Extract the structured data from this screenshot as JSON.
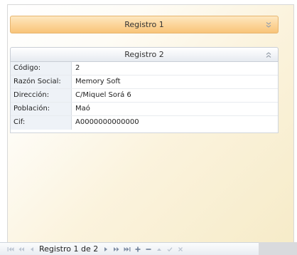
{
  "panels": [
    {
      "title": "Registro 1",
      "collapsed": true,
      "chevron": "double-chevron-down-icon"
    },
    {
      "title": "Registro 2",
      "collapsed": false,
      "chevron": "double-chevron-up-icon"
    }
  ],
  "record": {
    "fields": [
      {
        "label": "Código:",
        "value": "2"
      },
      {
        "label": "Razón Social:",
        "value": "Memory Soft"
      },
      {
        "label": "Dirección:",
        "value": "C/Miquel Sorá 6"
      },
      {
        "label": "Población:",
        "value": "Maó"
      },
      {
        "label": "Cif:",
        "value": "A0000000000000"
      }
    ]
  },
  "navigator": {
    "text": "Registro 1 de 2",
    "buttons": {
      "first": "⏮",
      "prev_page": "«",
      "prev": "◂",
      "next": "▸",
      "next_page": "»",
      "last": "⏭",
      "add": "+",
      "delete": "−",
      "edit": "▴",
      "post": "✓",
      "cancel": "✕"
    }
  },
  "colors": {
    "active_header": "#fcd59a",
    "active_border": "#e7b56f",
    "inactive_header": "#eef1f5",
    "label_bg": "#eef2f7"
  }
}
